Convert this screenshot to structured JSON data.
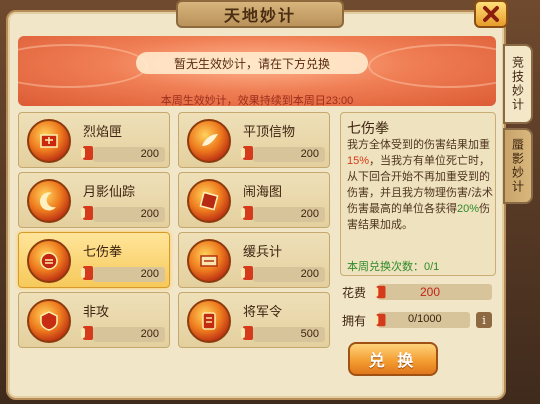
{
  "window": {
    "title": "天地妙计"
  },
  "banner": {
    "notice": "暂无生效妙计，请在下方兑换",
    "effect_text": "本周生效妙计，效果持续到本周日23:00"
  },
  "items": [
    {
      "name": "烈焰匣",
      "cost": "200",
      "icon": "fire-box-icon",
      "selected": false
    },
    {
      "name": "平顶信物",
      "cost": "200",
      "icon": "feather-token-icon",
      "selected": false
    },
    {
      "name": "月影仙踪",
      "cost": "200",
      "icon": "moon-shadow-icon",
      "selected": false
    },
    {
      "name": "闹海图",
      "cost": "200",
      "icon": "sea-map-icon",
      "selected": false
    },
    {
      "name": "七伤拳",
      "cost": "200",
      "icon": "fist-icon",
      "selected": true
    },
    {
      "name": "缓兵计",
      "cost": "200",
      "icon": "scroll-plan-icon",
      "selected": false
    },
    {
      "name": "非攻",
      "cost": "200",
      "icon": "shield-pact-icon",
      "selected": false
    },
    {
      "name": "将军令",
      "cost": "500",
      "icon": "general-order-icon",
      "selected": false
    }
  ],
  "detail": {
    "title": "七伤拳",
    "desc_1": "我方全体受到的伤害结果加重",
    "desc_pct1": "15%",
    "desc_2": "，当我方有单位死亡时，从下回合开始不再加重受到的伤害，并且我方物理伤害/法术伤害最高的单位各获得",
    "desc_pct2": "20%",
    "desc_3": "伤害结果加成。",
    "weekly_label": "本周兑换次数：0/1"
  },
  "cost_row": {
    "label": "花费",
    "value": "200"
  },
  "own_row": {
    "label": "拥有",
    "value": "0/1000",
    "info": "i"
  },
  "exchange_button": "兑 换",
  "side_tabs": [
    {
      "label": "竞技妙计",
      "active": true
    },
    {
      "label": "蜃影妙计",
      "active": false
    }
  ],
  "colors": {
    "accent": "#f29a2e",
    "highlight_red": "#d23a1a",
    "highlight_green": "#2f8a2a"
  }
}
